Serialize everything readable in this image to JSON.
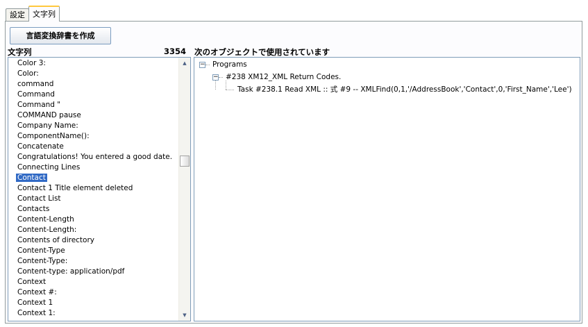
{
  "tabs": [
    "設定",
    "文字列"
  ],
  "create_button_label": "言語変換辞書を作成",
  "string_list": {
    "label": "文字列",
    "count": "3354",
    "selected": "Contact",
    "items": [
      "Color 3:",
      "Color:",
      "command",
      "Command",
      "Command \"",
      "COMMAND pause",
      "Company Name:",
      "ComponentName():",
      "Concatenate",
      "Congratulations! You entered a good date.",
      "Connecting Lines",
      "Contact",
      "Contact 1 Title element deleted",
      "Contact List",
      "Contacts",
      "Content-Length",
      "Content-Length:",
      "Contents of directory",
      "Content-Type",
      "Content-Type:",
      "Content-type: application/pdf",
      "Context",
      "Context #:",
      "Context 1",
      "Context 1:"
    ]
  },
  "usage": {
    "label": "次のオブジェクトで使用されています",
    "tree": {
      "root": "Programs",
      "child": "#238 XM12_XML Return Codes.",
      "leaf": "Task #238.1  Read XML  ::  式 #9 -- XMLFind(0,1,'/AddressBook','Contact',0,'First_Name','Lee')"
    }
  }
}
